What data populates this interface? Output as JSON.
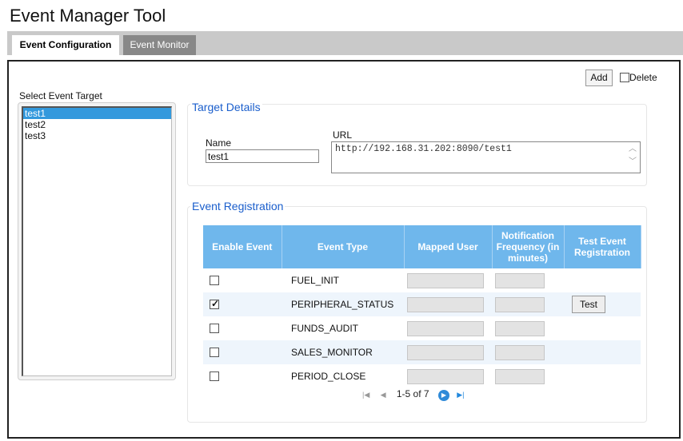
{
  "app": {
    "title": "Event Manager Tool"
  },
  "tabs": [
    {
      "label": "Event Configuration",
      "active": true
    },
    {
      "label": "Event Monitor",
      "active": false
    }
  ],
  "toolbar": {
    "add_label": "Add",
    "delete_label": "Delete",
    "delete_checked": false
  },
  "targets": {
    "label": "Select Event Target",
    "items": [
      "test1",
      "test2",
      "test3"
    ],
    "selected": "test1"
  },
  "target_details": {
    "title": "Target Details",
    "name_label": "Name",
    "name_value": "test1",
    "url_label": "URL",
    "url_value": "http://192.168.31.202:8090/test1"
  },
  "event_registration": {
    "title": "Event Registration",
    "columns": [
      "Enable Event",
      "Event Type",
      "Mapped User",
      "Notification Frequency (in minutes)",
      "Test Event Registration"
    ],
    "rows": [
      {
        "enabled": false,
        "type": "FUEL_INIT",
        "mapped_user": "",
        "frequency": "",
        "test": ""
      },
      {
        "enabled": true,
        "type": "PERIPHERAL_STATUS",
        "mapped_user": "",
        "frequency": "",
        "test": "Test"
      },
      {
        "enabled": false,
        "type": "FUNDS_AUDIT",
        "mapped_user": "",
        "frequency": "",
        "test": ""
      },
      {
        "enabled": false,
        "type": "SALES_MONITOR",
        "mapped_user": "",
        "frequency": "",
        "test": ""
      },
      {
        "enabled": false,
        "type": "PERIOD_CLOSE",
        "mapped_user": "",
        "frequency": "",
        "test": ""
      }
    ]
  },
  "pager": {
    "text": "1-5 of 7"
  },
  "colors": {
    "header_blue": "#6fb7ec",
    "legend_blue": "#1a5ecc",
    "selection_blue": "#3399dd"
  },
  "icons": [
    "first-page-icon",
    "prev-page-icon",
    "next-page-icon",
    "last-page-icon",
    "checkmark-icon"
  ]
}
